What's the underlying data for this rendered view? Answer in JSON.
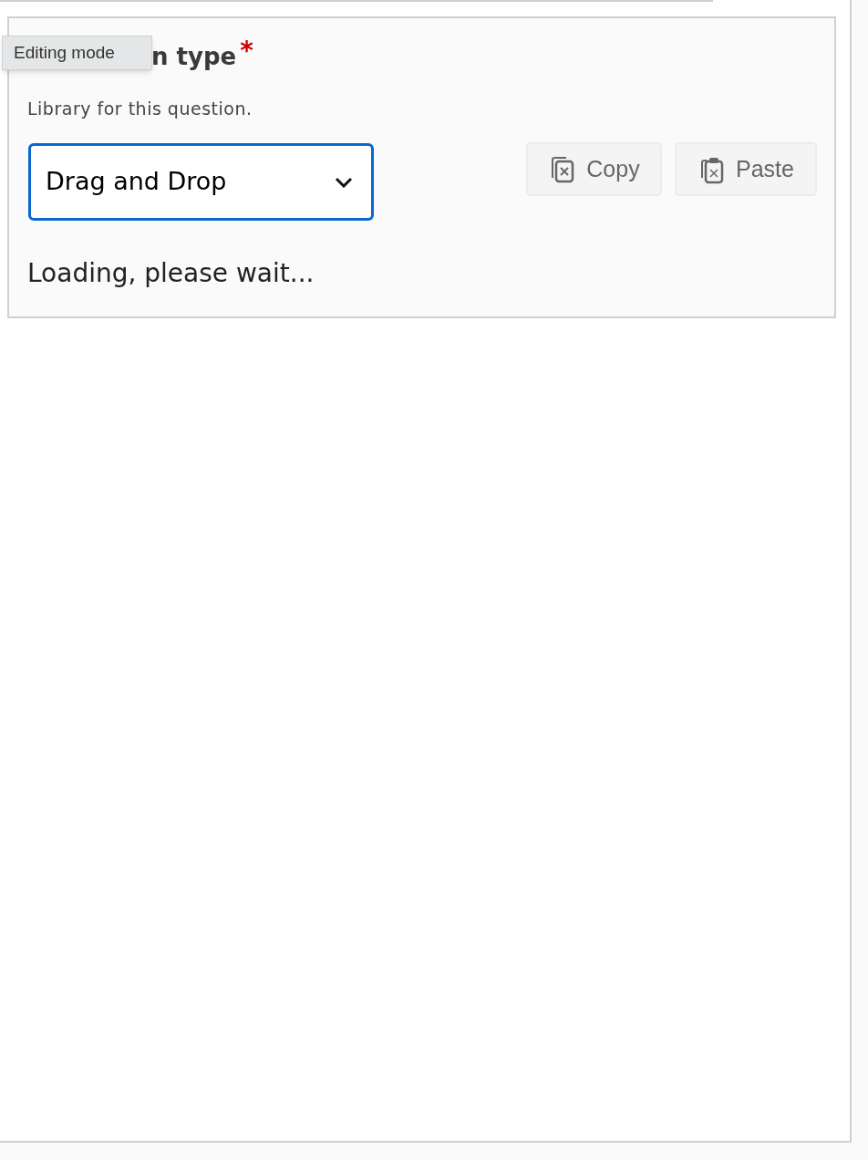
{
  "tooltip": {
    "text": "Editing mode"
  },
  "field": {
    "title": "n type",
    "required_mark": "*",
    "description": "Library for this question.",
    "select": {
      "value": "Drag and Drop",
      "focused": true
    }
  },
  "buttons": [
    {
      "kind": "copy",
      "label": "Copy"
    },
    {
      "kind": "paste",
      "label": "Paste"
    }
  ],
  "status": "Loading, please wait..."
}
